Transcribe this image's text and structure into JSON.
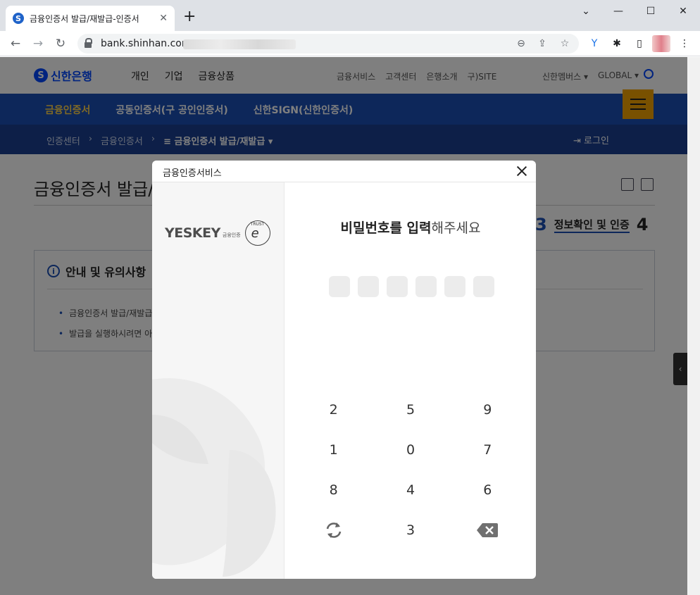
{
  "browser": {
    "tab_title": "금융인증서 발급/재발급-인증서",
    "tab_favicon": "S",
    "url": "bank.shinhan.com",
    "new_tab": "+",
    "minimize": "—",
    "maximize": "☐",
    "close": "✕",
    "back": "←",
    "forward": "→",
    "reload": "↻",
    "menu": "⋮"
  },
  "site": {
    "logo_mark": "S",
    "logo_text": "신한은행",
    "gnb": [
      "개인",
      "기업",
      "금융상품"
    ],
    "util": [
      "금융서비스",
      "고객센터",
      "은행소개",
      "구)SITE"
    ],
    "util_right": [
      "신한멤버스 ▾",
      "GLOBAL ▾"
    ],
    "blue_tabs": [
      "금융인증서",
      "공동인증서(구 공인인증서)",
      "신한SIGN(신한인증서)"
    ],
    "crumbs": [
      "인증센터",
      "›",
      "금융인증서",
      "›"
    ],
    "crumb_current": "≡ 금융인증서 발급/재발급 ▾",
    "login": "로그인",
    "page_title": "금융인증서 발급/",
    "step3_num": "3",
    "step3_label": "정보확인 및 인증",
    "step4_num": "4",
    "notice_title": "안내 및 유의사항",
    "notice_items": [
      "금융인증서 발급/재발급",
      "발급을 실행하시려면 아래"
    ],
    "side_tab": "‹"
  },
  "modal": {
    "title": "금융인증서비스",
    "brand": "YESKEY",
    "brand_sub": "금융인증",
    "esign_top": "TRUST",
    "esign_letter": "e",
    "prompt_bold": "비밀번호를 입력",
    "prompt_rest": "해주세요",
    "keypad": [
      "2",
      "5",
      "9",
      "1",
      "0",
      "7",
      "8",
      "4",
      "6",
      "refresh-icon",
      "3",
      "backspace-icon"
    ]
  }
}
